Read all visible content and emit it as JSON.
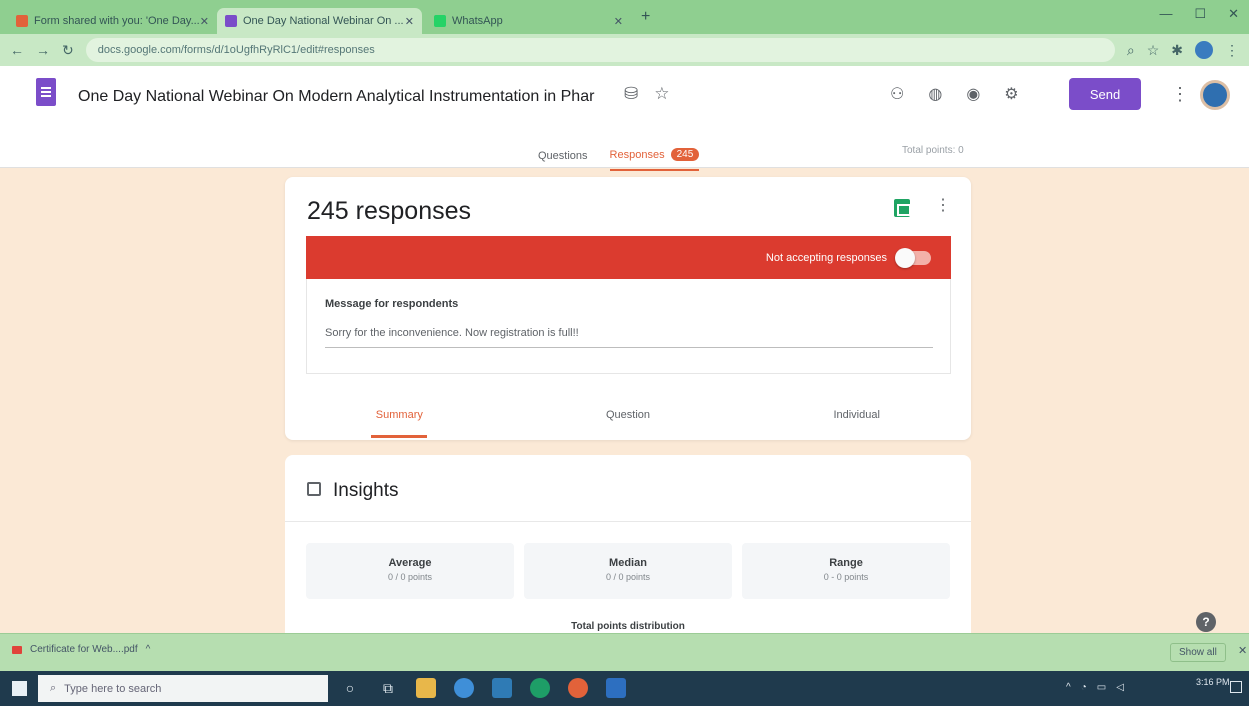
{
  "browser": {
    "tabs": [
      {
        "title": "Form shared with you: 'One Day...",
        "color": "#e2623a"
      },
      {
        "title": "One Day National Webinar On ...",
        "color": "#7b4dc9"
      },
      {
        "title": "WhatsApp",
        "color": "#25d366"
      }
    ],
    "new_tab": "+",
    "url": "docs.google.com/forms/d/1oUgfhRyRlC1/edit#responses"
  },
  "form": {
    "title": "One Day National Webinar  On Modern Analytical Instrumentation in Phar",
    "send_label": "Send",
    "nav": {
      "questions": "Questions",
      "responses": "Responses",
      "responses_count": "245"
    },
    "total_points": "Total points: 0"
  },
  "responses": {
    "count_label": "245 responses",
    "not_accepting": "Not accepting responses",
    "message_label": "Message for respondents",
    "message_text": "Sorry for the inconvenience. Now registration is full!!",
    "tabs": [
      "Summary",
      "Question",
      "Individual"
    ]
  },
  "insights": {
    "title": "Insights",
    "stats": [
      {
        "label": "Average",
        "value": "0 / 0 points"
      },
      {
        "label": "Median",
        "value": "0 / 0 points"
      },
      {
        "label": "Range",
        "value": "0 - 0 points"
      }
    ],
    "distribution_title": "Total points distribution"
  },
  "download_bar": {
    "file": "Certificate for Web....pdf",
    "show_all": "Show all"
  },
  "taskbar": {
    "search_placeholder": "Type here to search",
    "time": "3:16 PM"
  }
}
